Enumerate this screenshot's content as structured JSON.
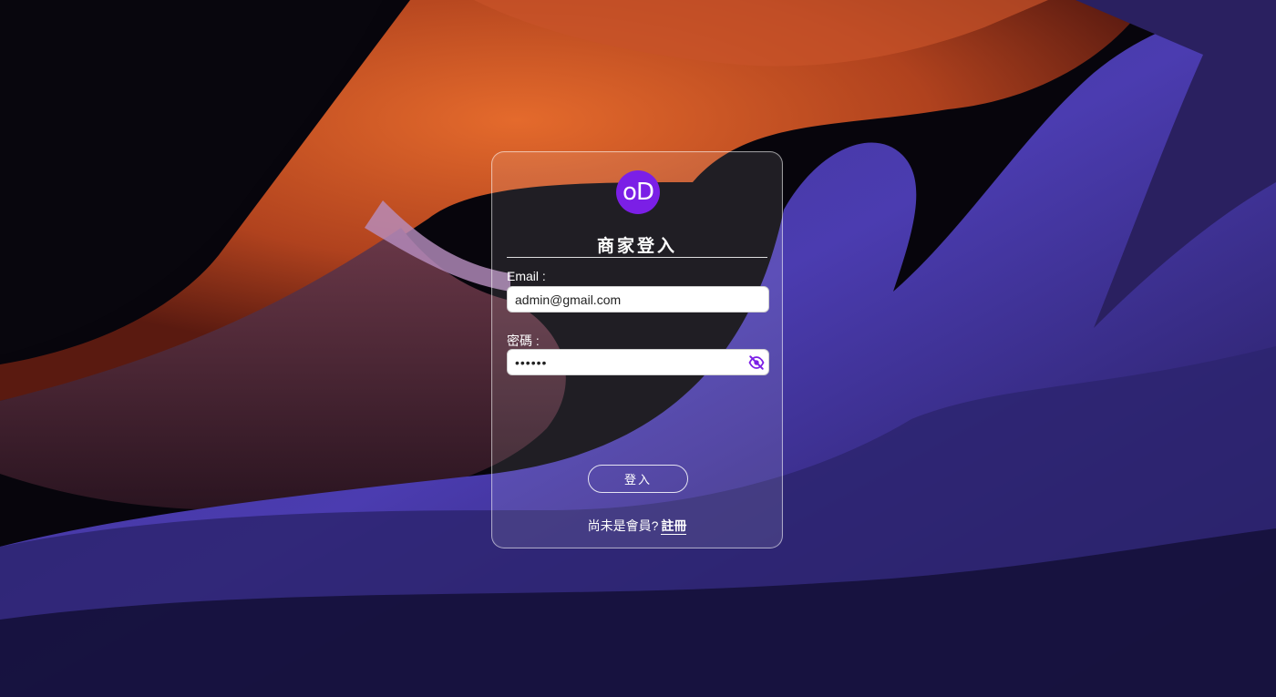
{
  "background": {
    "description_icon": "canyon-background"
  },
  "logo": {
    "text": "oD",
    "color": "#7b1fe6"
  },
  "title": "商家登入",
  "email": {
    "label": "Email :",
    "value": "admin@gmail.com"
  },
  "password": {
    "label": "密碼 :",
    "value": "••••••",
    "toggle_icon": "eye-off-icon",
    "toggle_color": "#7b1fe6"
  },
  "login_button": "登入",
  "footer": {
    "prompt": "尚未是會員?",
    "link": "註冊"
  }
}
